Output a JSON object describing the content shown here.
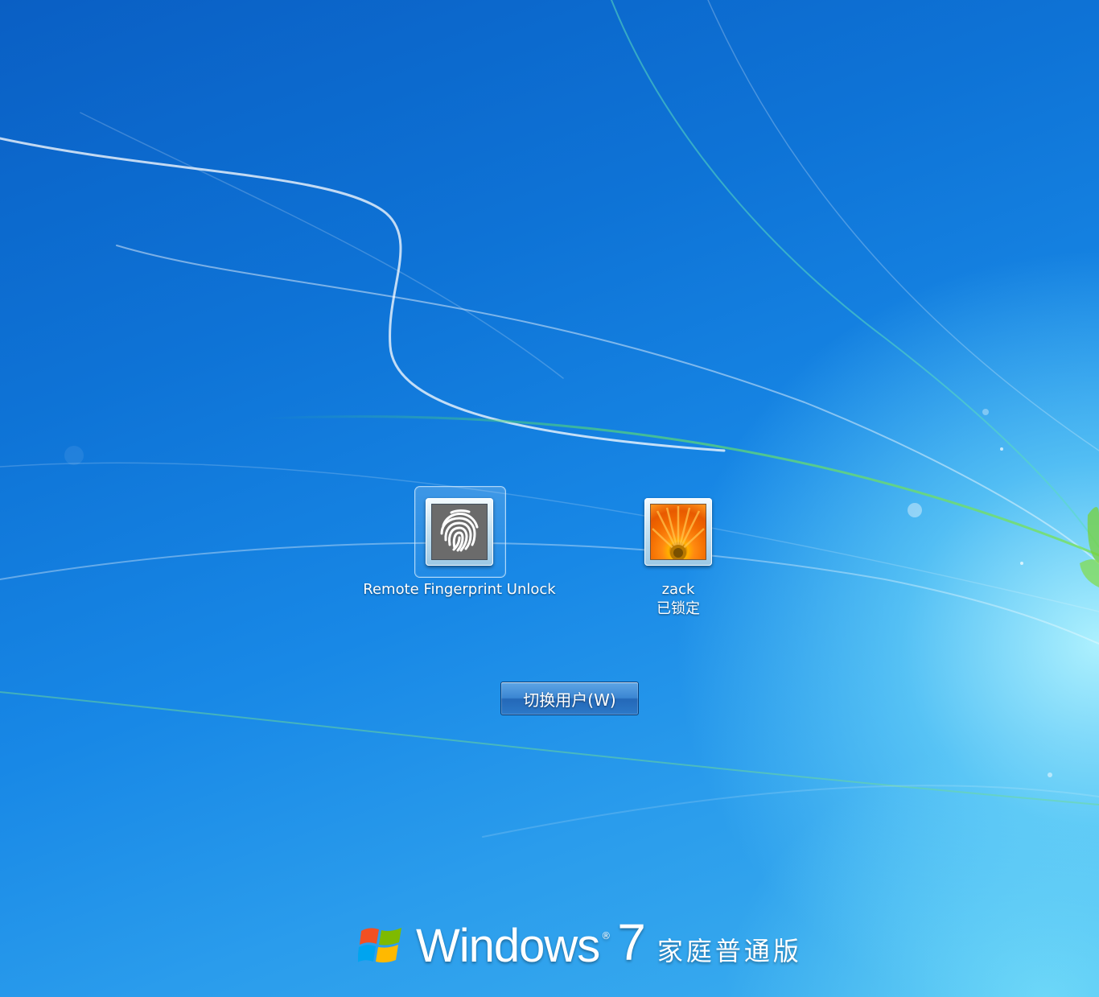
{
  "users": [
    {
      "name": "Remote Fingerprint Unlock",
      "status": "",
      "icon": "fingerprint-icon",
      "selected": true
    },
    {
      "name": "zack",
      "status": "已锁定",
      "icon": "orange-flower-picture",
      "selected": false
    }
  ],
  "switch_user_button": {
    "label": "切换用户(W)"
  },
  "branding": {
    "product": "Windows",
    "registered": "®",
    "version": "7",
    "edition": "家庭普通版"
  },
  "colors": {
    "background_deep": "#0a5fc4",
    "background_light": "#b4f5ff",
    "fingerprint_tile": "#6b6b6b",
    "flower": "#ff7a10"
  }
}
